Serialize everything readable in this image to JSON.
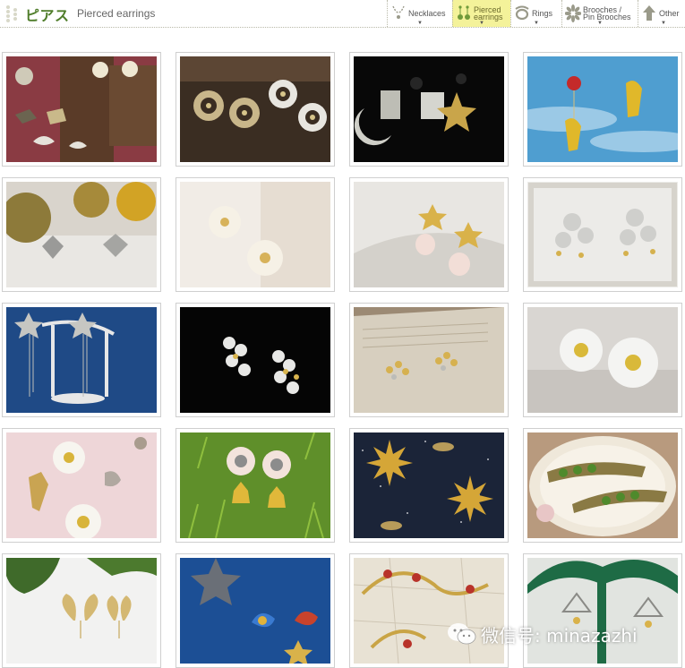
{
  "header": {
    "title": "ピアス",
    "subtitle": "Pierced earrings"
  },
  "nav": {
    "items": [
      {
        "label": "Necklaces",
        "icon": "necklace-icon",
        "active": false
      },
      {
        "label": "Pierced\nearrings",
        "icon": "earring-icon",
        "active": true
      },
      {
        "label": "Rings",
        "icon": "ring-icon",
        "active": false
      },
      {
        "label": "Brooches /\nPin Brooches",
        "icon": "brooch-icon",
        "active": false
      },
      {
        "label": "Other",
        "icon": "tree-arrow-icon",
        "active": false
      }
    ],
    "arrow": "▼"
  },
  "products": [
    {
      "depicts": "bird-and-pearl-earrings"
    },
    {
      "depicts": "sun-ring-earrings"
    },
    {
      "depicts": "moon-and-star-kanji-earrings"
    },
    {
      "depicts": "squirrel-and-red-berry-earrings"
    },
    {
      "depicts": "butterfly-earrings"
    },
    {
      "depicts": "white-flower-earrings"
    },
    {
      "depicts": "star-and-pearl-drop-earrings"
    },
    {
      "depicts": "silver-leaf-cluster-earrings"
    },
    {
      "depicts": "star-tassel-earrings"
    },
    {
      "depicts": "heart-leaf-cluster-earrings"
    },
    {
      "depicts": "gold-leaf-sprig-earrings"
    },
    {
      "depicts": "daisy-earrings"
    },
    {
      "depicts": "daisy-and-bird-earrings"
    },
    {
      "depicts": "sheep-and-bell-earrings"
    },
    {
      "depicts": "starburst-earrings"
    },
    {
      "depicts": "pea-pod-earrings"
    },
    {
      "depicts": "gold-butterfly-stud-earrings"
    },
    {
      "depicts": "bluebird-earrings"
    },
    {
      "depicts": "gold-vine-and-bird-earrings"
    },
    {
      "depicts": "triangle-drop-earrings"
    }
  ],
  "watermark": {
    "icon": "wechat-icon",
    "text": "微信号: minazazhi"
  },
  "colors": {
    "brand_green": "#4f7d2a",
    "active_nav": "#f4f29a",
    "tile_border": "#cfcfcf"
  }
}
